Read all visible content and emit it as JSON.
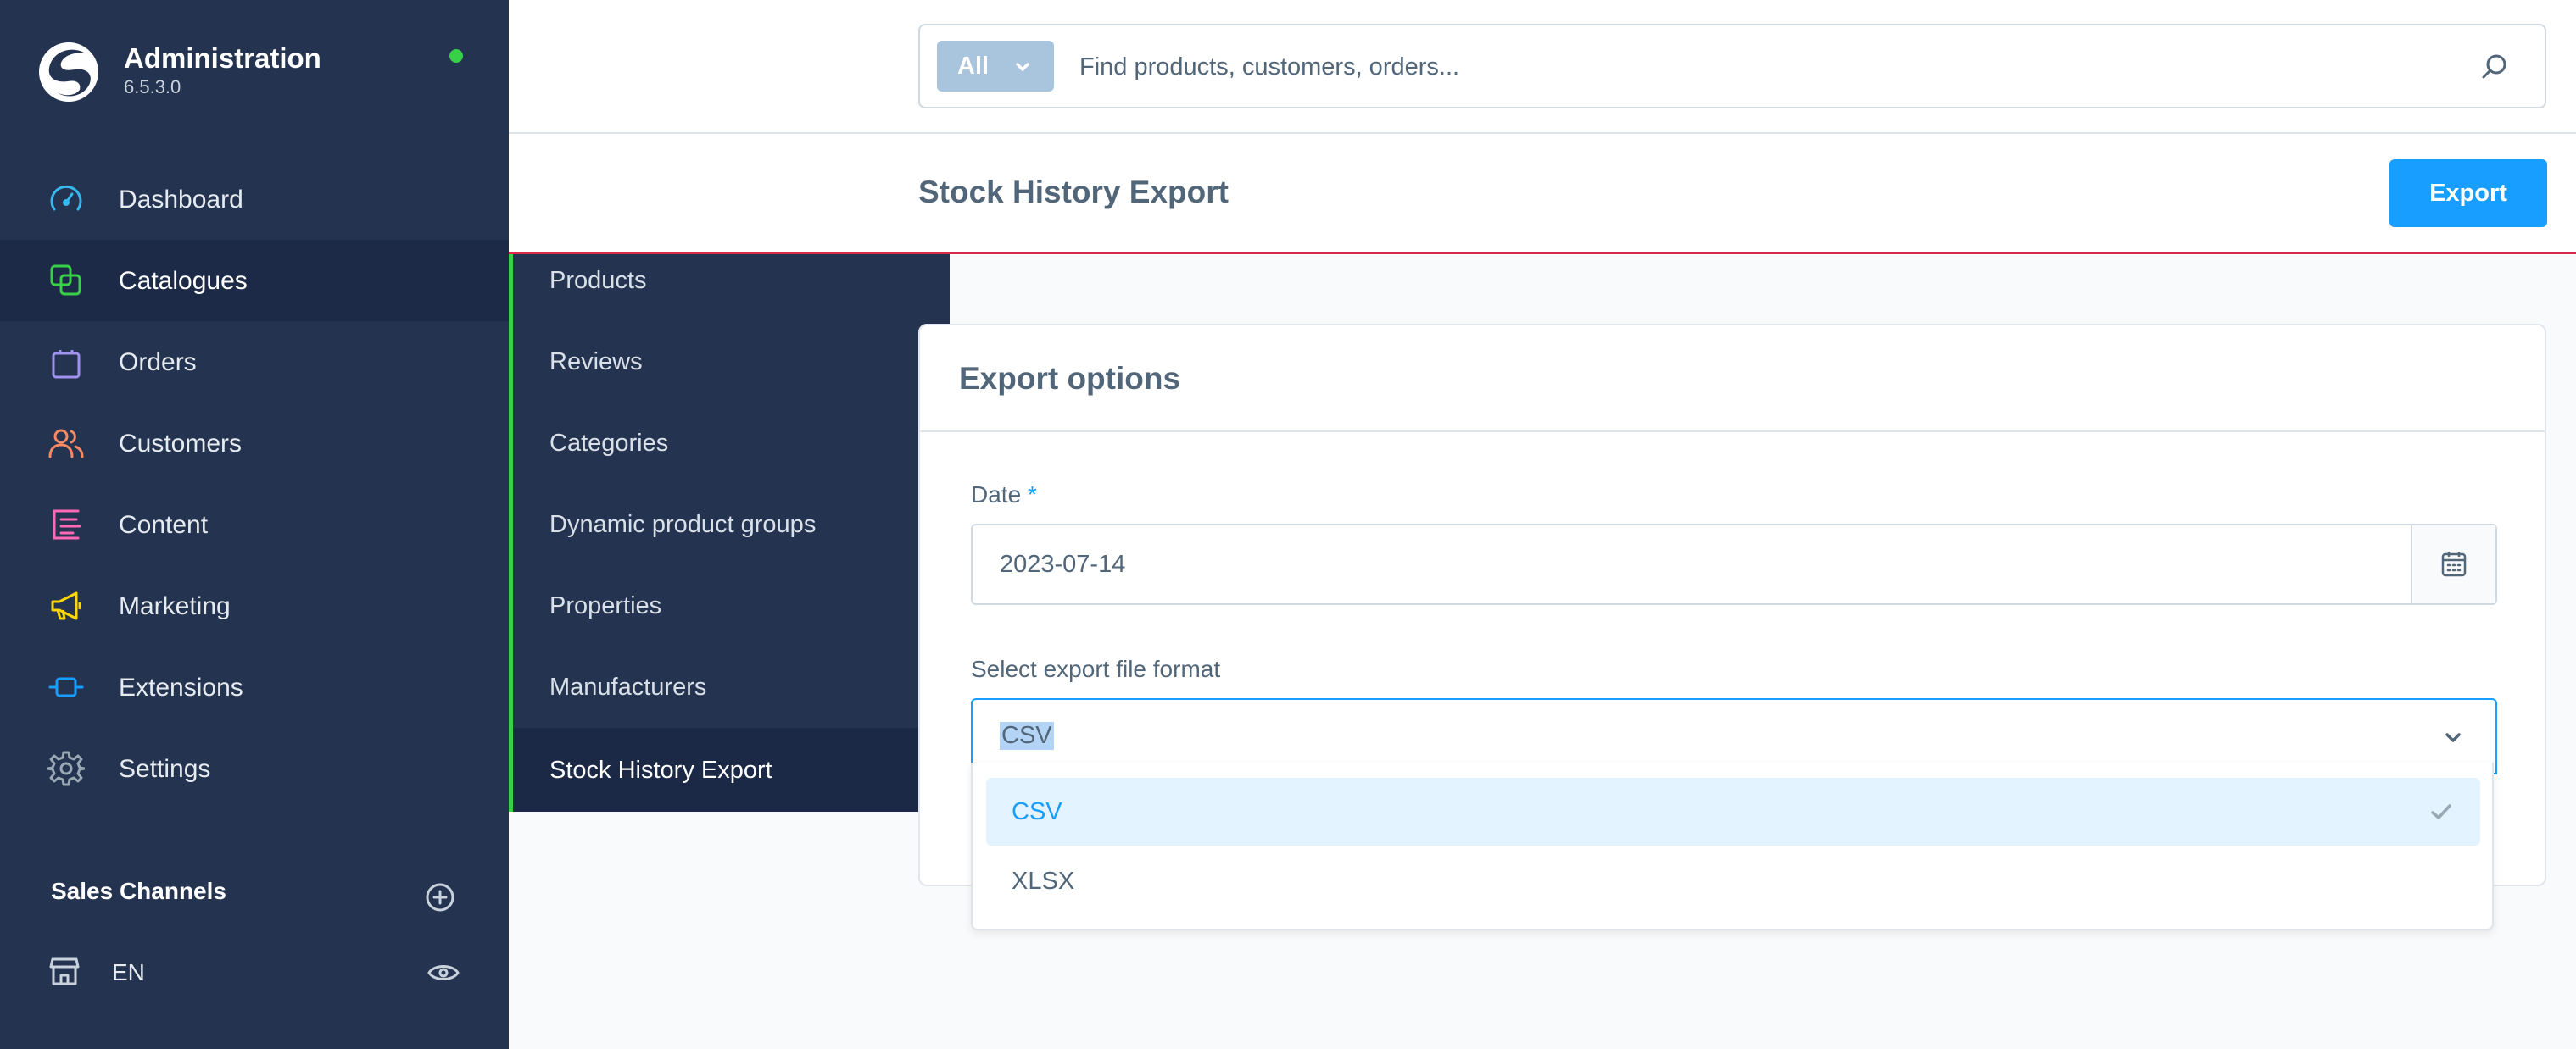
{
  "brand": {
    "title": "Administration",
    "version": "6.5.3.0"
  },
  "nav": {
    "items": [
      {
        "label": "Dashboard",
        "icon": "dashboard-gauge-icon",
        "color": "#35b9f0"
      },
      {
        "label": "Catalogues",
        "icon": "catalogue-stack-icon",
        "color": "#37d046",
        "active": true
      },
      {
        "label": "Orders",
        "icon": "shopping-bag-icon",
        "color": "#a092f0"
      },
      {
        "label": "Customers",
        "icon": "users-icon",
        "color": "#f88962"
      },
      {
        "label": "Content",
        "icon": "content-layout-icon",
        "color": "#ff68b4"
      },
      {
        "label": "Marketing",
        "icon": "megaphone-icon",
        "color": "#ffd700"
      },
      {
        "label": "Extensions",
        "icon": "plugin-icon",
        "color": "#189eff"
      },
      {
        "label": "Settings",
        "icon": "gear-icon",
        "color": "#9aa8b5"
      }
    ]
  },
  "flyout": {
    "items": [
      {
        "label": "Products"
      },
      {
        "label": "Reviews"
      },
      {
        "label": "Categories"
      },
      {
        "label": "Dynamic product groups"
      },
      {
        "label": "Properties"
      },
      {
        "label": "Manufacturers"
      },
      {
        "label": "Stock History Export",
        "active": true
      }
    ]
  },
  "sales_channels": {
    "heading": "Sales Channels",
    "items": [
      {
        "label": "EN"
      }
    ]
  },
  "search": {
    "type_label": "All",
    "placeholder": "Find products, customers, orders..."
  },
  "page": {
    "title": "Stock History Export",
    "export_label": "Export"
  },
  "card": {
    "title": "Export options",
    "date_label": "Date",
    "required_mark": "*",
    "date_value": "2023-07-14",
    "format_label": "Select export file format",
    "format_value": "CSV",
    "options": [
      {
        "label": "CSV",
        "selected": true
      },
      {
        "label": "XLSX",
        "selected": false
      }
    ]
  },
  "colors": {
    "sidebar_bg": "#243350",
    "accent_blue": "#189eff",
    "catalogue_green": "#37d046",
    "header_rule_red": "#de294c",
    "status_online": "#37d046"
  }
}
